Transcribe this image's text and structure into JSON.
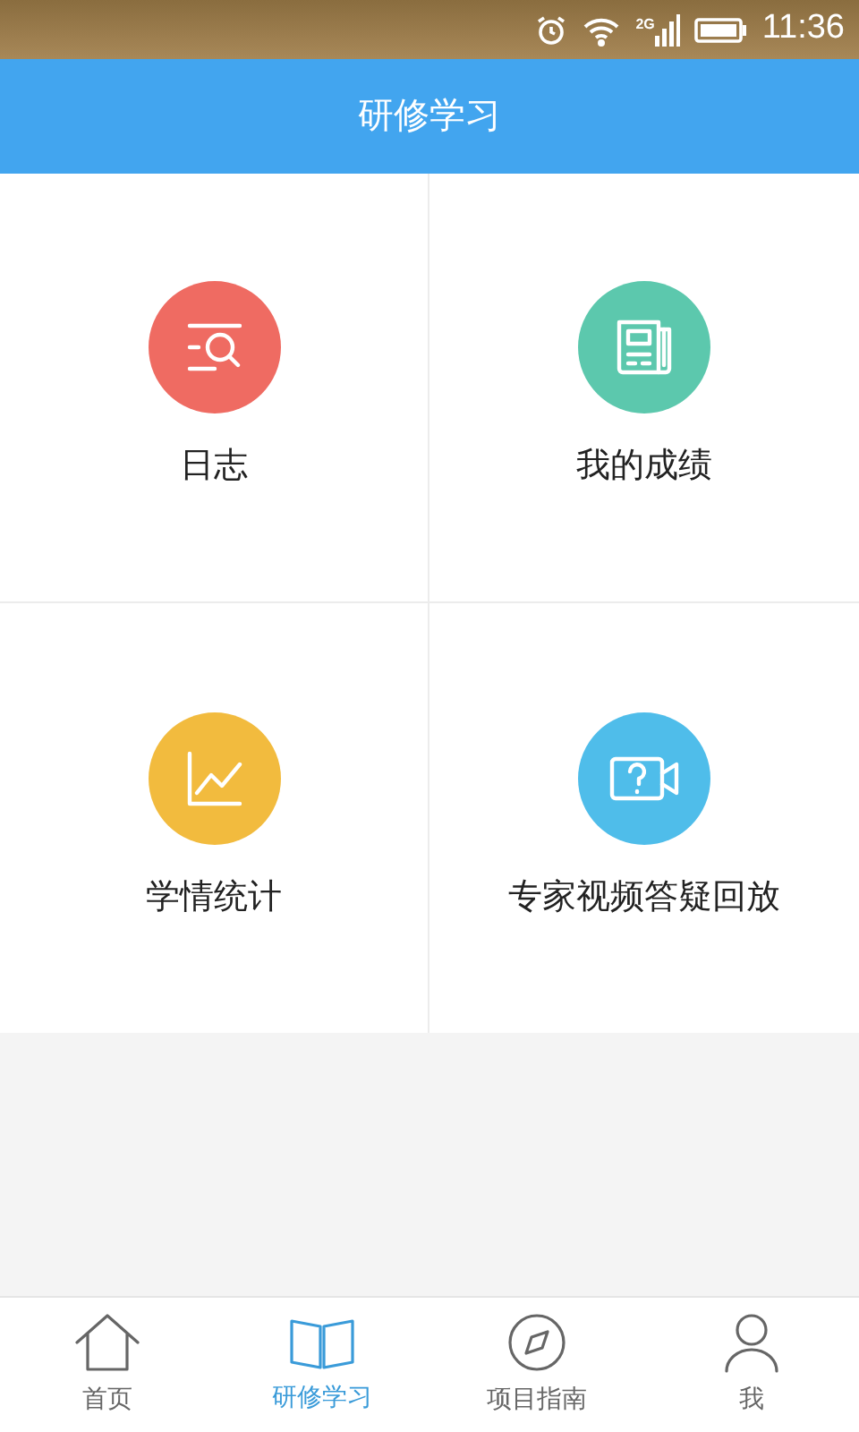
{
  "status_bar": {
    "network": "2G",
    "time": "11:36"
  },
  "header": {
    "title": "研修学习"
  },
  "tiles": [
    {
      "label": "日志",
      "kind": "journal",
      "color": "#ef6b62"
    },
    {
      "label": "我的成绩",
      "kind": "newspaper",
      "color": "#5cc8ad"
    },
    {
      "label": "学情统计",
      "kind": "chart",
      "color": "#f2bb3e"
    },
    {
      "label": "专家视频答疑回放",
      "kind": "video",
      "color": "#4fbdea"
    }
  ],
  "tabs": [
    {
      "label": "首页",
      "kind": "home",
      "selected": false
    },
    {
      "label": "研修学习",
      "kind": "book",
      "selected": true
    },
    {
      "label": "项目指南",
      "kind": "compass",
      "selected": false
    },
    {
      "label": "我",
      "kind": "person",
      "selected": false
    }
  ]
}
